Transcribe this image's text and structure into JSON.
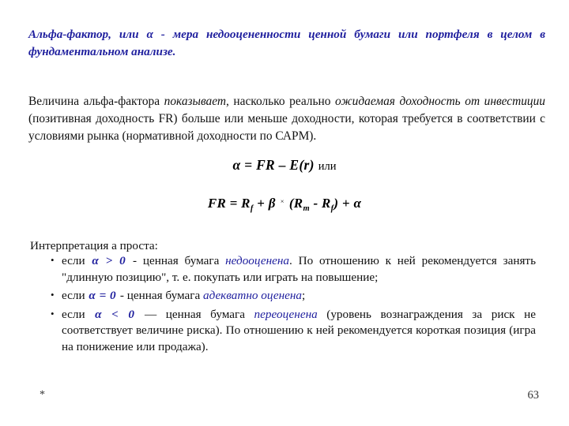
{
  "slide": {
    "background_color": "#ffffff",
    "accent_color": "#1f1f9e",
    "text_color": "#111111"
  },
  "title": {
    "line1": "Альфа-фактор, или α - мера недооцененности ценной бумаги или портфеля в",
    "line2": "целом в фундаментальном анализе."
  },
  "paragraph": {
    "seg1": "Величина альфа-фактора ",
    "em1": "показывает",
    "seg2": ", насколько реально ",
    "em2": "ожидаемая доходность от инвестиции",
    "seg3": " (позитивная доходность FR) больше или меньше доходности, которая требуется в соответствии с условиями рынка (нормативной доходности по САРМ)."
  },
  "formulas": {
    "f1": {
      "expression": "α = FR – E(r)",
      "suffix": "или"
    },
    "f2": {
      "lead": "FR = R",
      "sub1": "f",
      "mid1": " + β",
      "times": "×",
      "mid2": "(R",
      "sub2": "m",
      "mid3": " - R",
      "sub3": "f",
      "tail": ") + α"
    }
  },
  "interpretation": {
    "heading": "Интерпретация a проста:",
    "bullets": [
      {
        "pre": "если ",
        "cond": "α > 0",
        "mid": " - ценная бумага ",
        "em": "недооценена",
        "post": ". По отношению к ней рекомендуется занять \"длинную позицию\", т. е. покупать или играть на повышение;"
      },
      {
        "pre": "если ",
        "cond": "α = 0",
        "mid": " - ценная бумага ",
        "em": "адекватно оценена",
        "post": ";"
      },
      {
        "pre": "если ",
        "cond": "α < 0",
        "mid": " — ценная бумага ",
        "em": "переоценена",
        "post": " (уровень вознаграждения за риск не соответствует величине риска). По отношению к ней рекомендуется короткая позиция (игра на понижение или продажа)."
      }
    ]
  },
  "footer": {
    "star": "*",
    "page_number": "63"
  }
}
